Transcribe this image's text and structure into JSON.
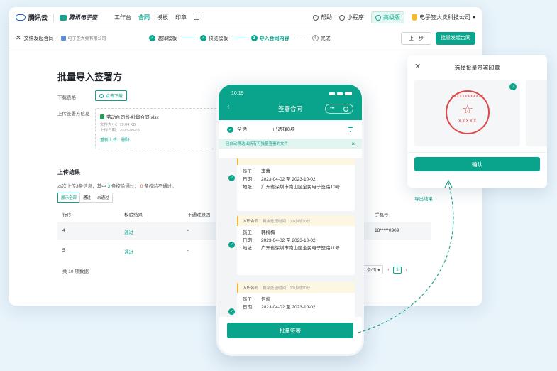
{
  "topbar": {
    "brand": "腾讯云",
    "product": "腾讯电子签",
    "nav": [
      "工作台",
      "合同",
      "模板",
      "印章"
    ],
    "active_nav": "合同",
    "help": "帮助",
    "miniapp": "小程序",
    "edition": "高级版",
    "company": "电子签大卖科技公司"
  },
  "stepbar": {
    "close_label": "文件发起合同",
    "org": "电子签大卖有限公司",
    "steps": [
      "选择模板",
      "预览模板",
      "导入合同内容",
      "完成"
    ],
    "step_nums": [
      "3",
      "4"
    ],
    "prev": "上一步",
    "submit": "批量发起合同"
  },
  "page": {
    "title": "批量导入签署方",
    "download_label": "下载表格",
    "download_btn": "点击下载",
    "upload_label": "上传签署方信息",
    "file_name": "劳动合同书-批量合同.xlsx",
    "file_size": "文件大小：19.04 KB",
    "upload_time": "上传日期：2023-09-03",
    "reupload": "重新上传",
    "delete": "删除",
    "result_title": "上传结果",
    "summary_prefix": "本次上传3条信息，其中",
    "pass_count": "3",
    "summary_mid": "条校验通过，",
    "fail_count": "0",
    "summary_suffix": "条校验不通过。",
    "filters": [
      "展示全部",
      "通过",
      "未通过"
    ],
    "export": "导出结果",
    "columns": [
      "行序",
      "校验结果",
      "不通过原因",
      "手机号"
    ],
    "rows": [
      {
        "idx": "4",
        "result": "通过",
        "reason": "-",
        "phone": "18*****0909"
      },
      {
        "idx": "5",
        "result": "通过",
        "reason": "-",
        "phone": ""
      }
    ],
    "total": "共 10 项数据",
    "per_page": "条/页",
    "page_num": "1"
  },
  "phone": {
    "time": "10:19",
    "title": "签署合同",
    "pill_dots": "•••",
    "select_all": "全选",
    "selected": "已选择8项",
    "notice": "已自动筛选出所有可批量签署的文件",
    "cards": [
      {
        "tag": "",
        "remain": "",
        "employee_k": "员工：",
        "employee": "李蕾",
        "date_k": "日期：",
        "date": "2023-04-02 至 2023-10-02",
        "addr_k": "地址：",
        "addr": "广东省深圳市南山区全民电子签路10号"
      },
      {
        "tag": "入职合同",
        "remain": "剩余处理时间：12小时30分",
        "employee_k": "员工：",
        "employee": "韩梅梅",
        "date_k": "日期：",
        "date": "2023-04-02 至 2023-10-02",
        "addr_k": "地址：",
        "addr": "广东省深圳市南山区全民电子签路11号"
      },
      {
        "tag": "入职合同",
        "remain": "剩余处理时间：12小时30分",
        "employee_k": "员工：",
        "employee": "何规",
        "date_k": "日期：",
        "date": "2023-04-02 至 2023-10-02",
        "addr_k": "",
        "addr": ""
      }
    ],
    "batch_btn": "批量签署"
  },
  "seal": {
    "title": "选择批量签署印章",
    "stamp_ring": "XXXXXXXXXXXX",
    "stamp_name": "XXXXX",
    "confirm": "确认"
  },
  "colors": {
    "accent": "#0aa48c",
    "stamp": "#e04848",
    "warn": "#f2b63b"
  }
}
